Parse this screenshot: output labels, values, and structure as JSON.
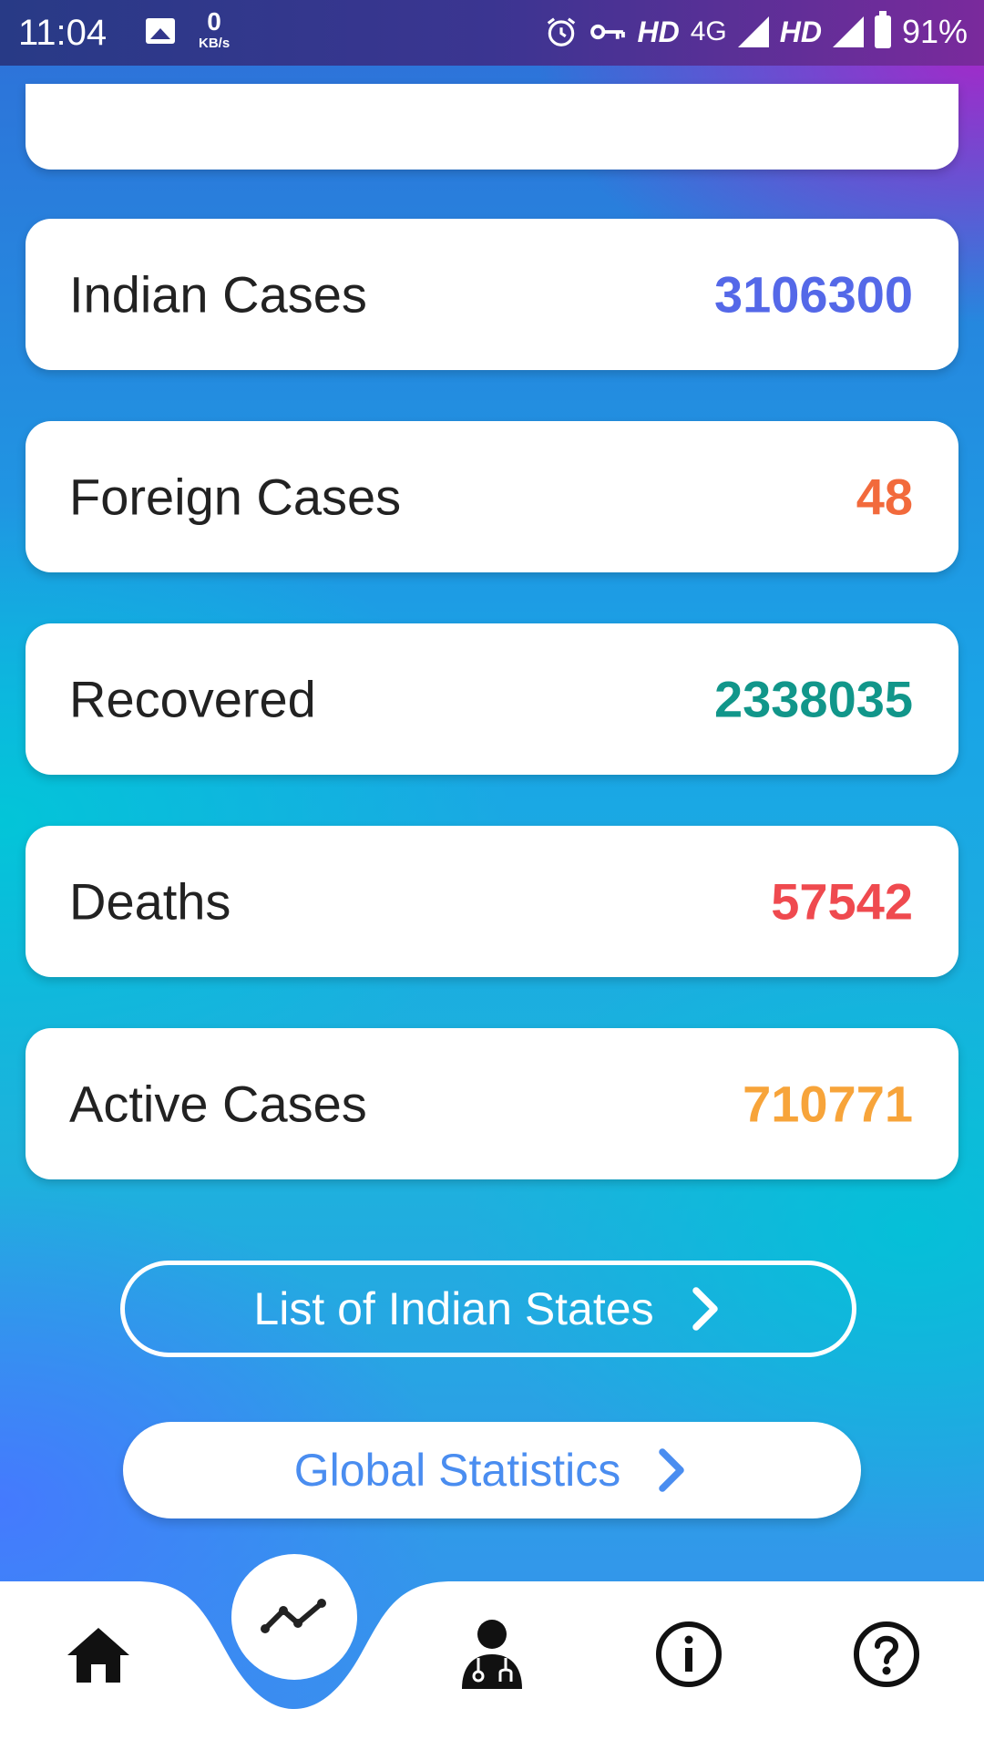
{
  "status_bar": {
    "time": "11:04",
    "speed_value": "0",
    "speed_unit": "KB/s",
    "hd1": "HD",
    "network": "4G",
    "hd2": "HD",
    "battery": "91%"
  },
  "stats": [
    {
      "label": "Indian Cases",
      "value": "3106300",
      "color": "#5468e8"
    },
    {
      "label": "Foreign Cases",
      "value": "48",
      "color": "#f26a3c"
    },
    {
      "label": "Recovered",
      "value": "2338035",
      "color": "#11968a"
    },
    {
      "label": "Deaths",
      "value": "57542",
      "color": "#ef4a4f"
    },
    {
      "label": "Active Cases",
      "value": "710771",
      "color": "#f7a43a"
    }
  ],
  "buttons": {
    "states_label": "List of Indian States",
    "global_label": "Global Statistics"
  },
  "nav": {
    "items": [
      "home-icon",
      "trend-chart-icon",
      "doctor-icon",
      "info-icon",
      "help-icon"
    ],
    "active": "trend-chart-icon"
  },
  "colors": {
    "accent": "#4a8df0",
    "nav_active": "#3f84f5"
  }
}
